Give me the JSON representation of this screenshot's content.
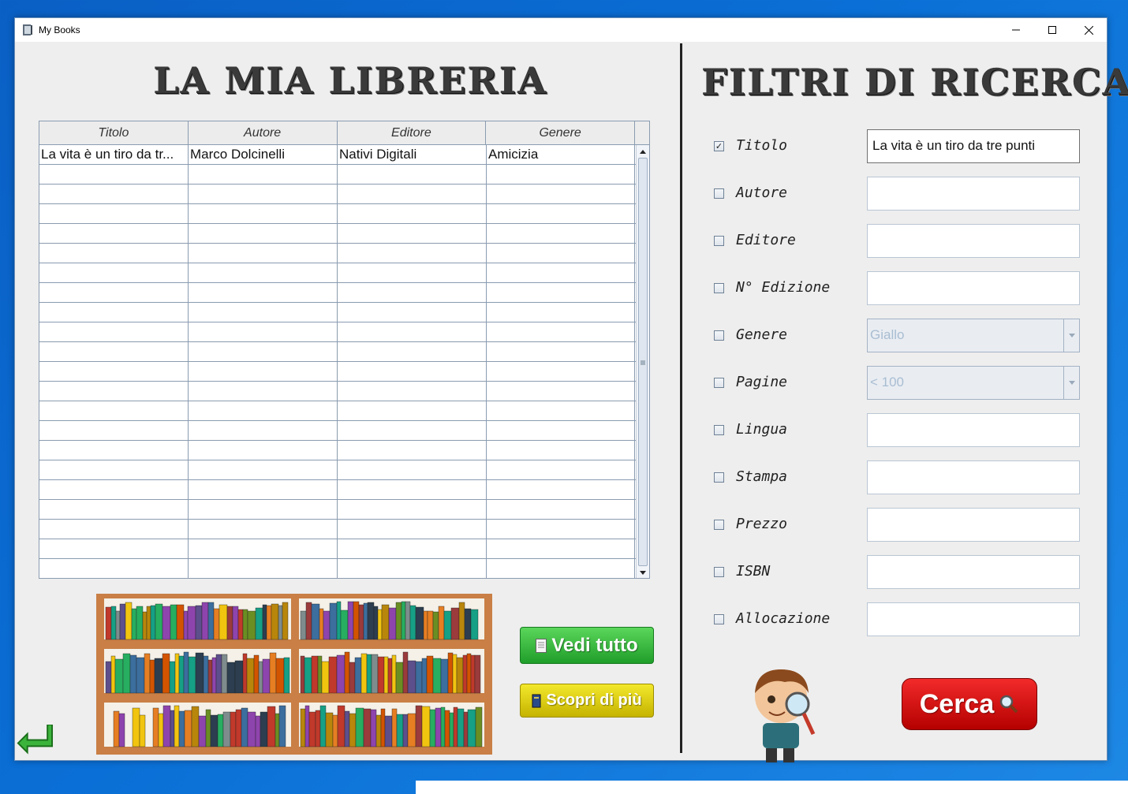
{
  "window": {
    "title": "My Books",
    "controls": [
      "minimize",
      "maximize",
      "close"
    ]
  },
  "library": {
    "heading": "LA MIA LIBRERIA",
    "columns": [
      "Titolo",
      "Autore",
      "Editore",
      "Genere"
    ],
    "rows": [
      [
        "La vita è un tiro da tr...",
        "Marco Dolcinelli",
        "Nativi Digitali",
        "Amicizia"
      ]
    ],
    "empty_rows": 21
  },
  "buttons": {
    "vedi_tutto": "Vedi tutto",
    "scopri": "Scopri di più",
    "cerca": "Cerca"
  },
  "filters": {
    "heading": "FILTRI DI RICERCA",
    "items": [
      {
        "label": "Titolo",
        "checked": true,
        "type": "text",
        "value": "La vita è un tiro da tre punti"
      },
      {
        "label": "Autore",
        "checked": false,
        "type": "text",
        "value": ""
      },
      {
        "label": "Editore",
        "checked": false,
        "type": "text",
        "value": ""
      },
      {
        "label": "N° Edizione",
        "checked": false,
        "type": "text",
        "value": ""
      },
      {
        "label": "Genere",
        "checked": false,
        "type": "select",
        "value": "Giallo"
      },
      {
        "label": "Pagine",
        "checked": false,
        "type": "select",
        "value": "< 100"
      },
      {
        "label": "Lingua",
        "checked": false,
        "type": "text",
        "value": ""
      },
      {
        "label": "Stampa",
        "checked": false,
        "type": "text",
        "value": ""
      },
      {
        "label": "Prezzo",
        "checked": false,
        "type": "text",
        "value": ""
      },
      {
        "label": "ISBN",
        "checked": false,
        "type": "text",
        "value": ""
      },
      {
        "label": "Allocazione",
        "checked": false,
        "type": "text",
        "value": ""
      }
    ]
  },
  "colors": {
    "green_button": "#1f9e2a",
    "yellow_button": "#c5b300",
    "red_button": "#b50000",
    "desktop": "#0a6fd6"
  },
  "icons": [
    "app-book-icon",
    "document-icon",
    "book-icon",
    "magnifier-icon",
    "back-arrow-icon"
  ]
}
